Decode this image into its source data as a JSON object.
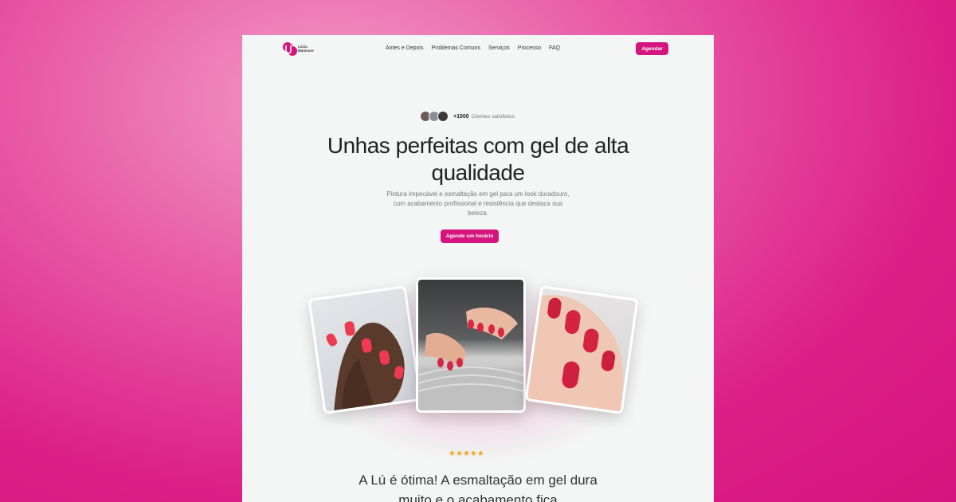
{
  "brand": {
    "logo_text_line1": "Lúcia",
    "logo_text_line2": "Manicure",
    "accent": "#d6147d"
  },
  "nav": {
    "items": [
      "Antes e Depois",
      "Problemas Comuns",
      "Serviços",
      "Processo",
      "FAQ"
    ],
    "cta": "Agendar"
  },
  "hero": {
    "proof_count": "+1000",
    "proof_label": "Clientes satisfeitos",
    "title": "Unhas perfeitas com gel de alta qualidade",
    "subtitle": "Pintura impecável e esmaltação em gel para um look duradouro, com acabamento profissional e resistência que destaca sua beleza.",
    "cta": "Agende um horário"
  },
  "testimonial": {
    "rating": 5,
    "stars": "★★★★★",
    "quote": "A Lú é ótima! A esmaltação em gel dura muito e o acabamento fica"
  },
  "icons": {
    "star": "star-icon"
  }
}
